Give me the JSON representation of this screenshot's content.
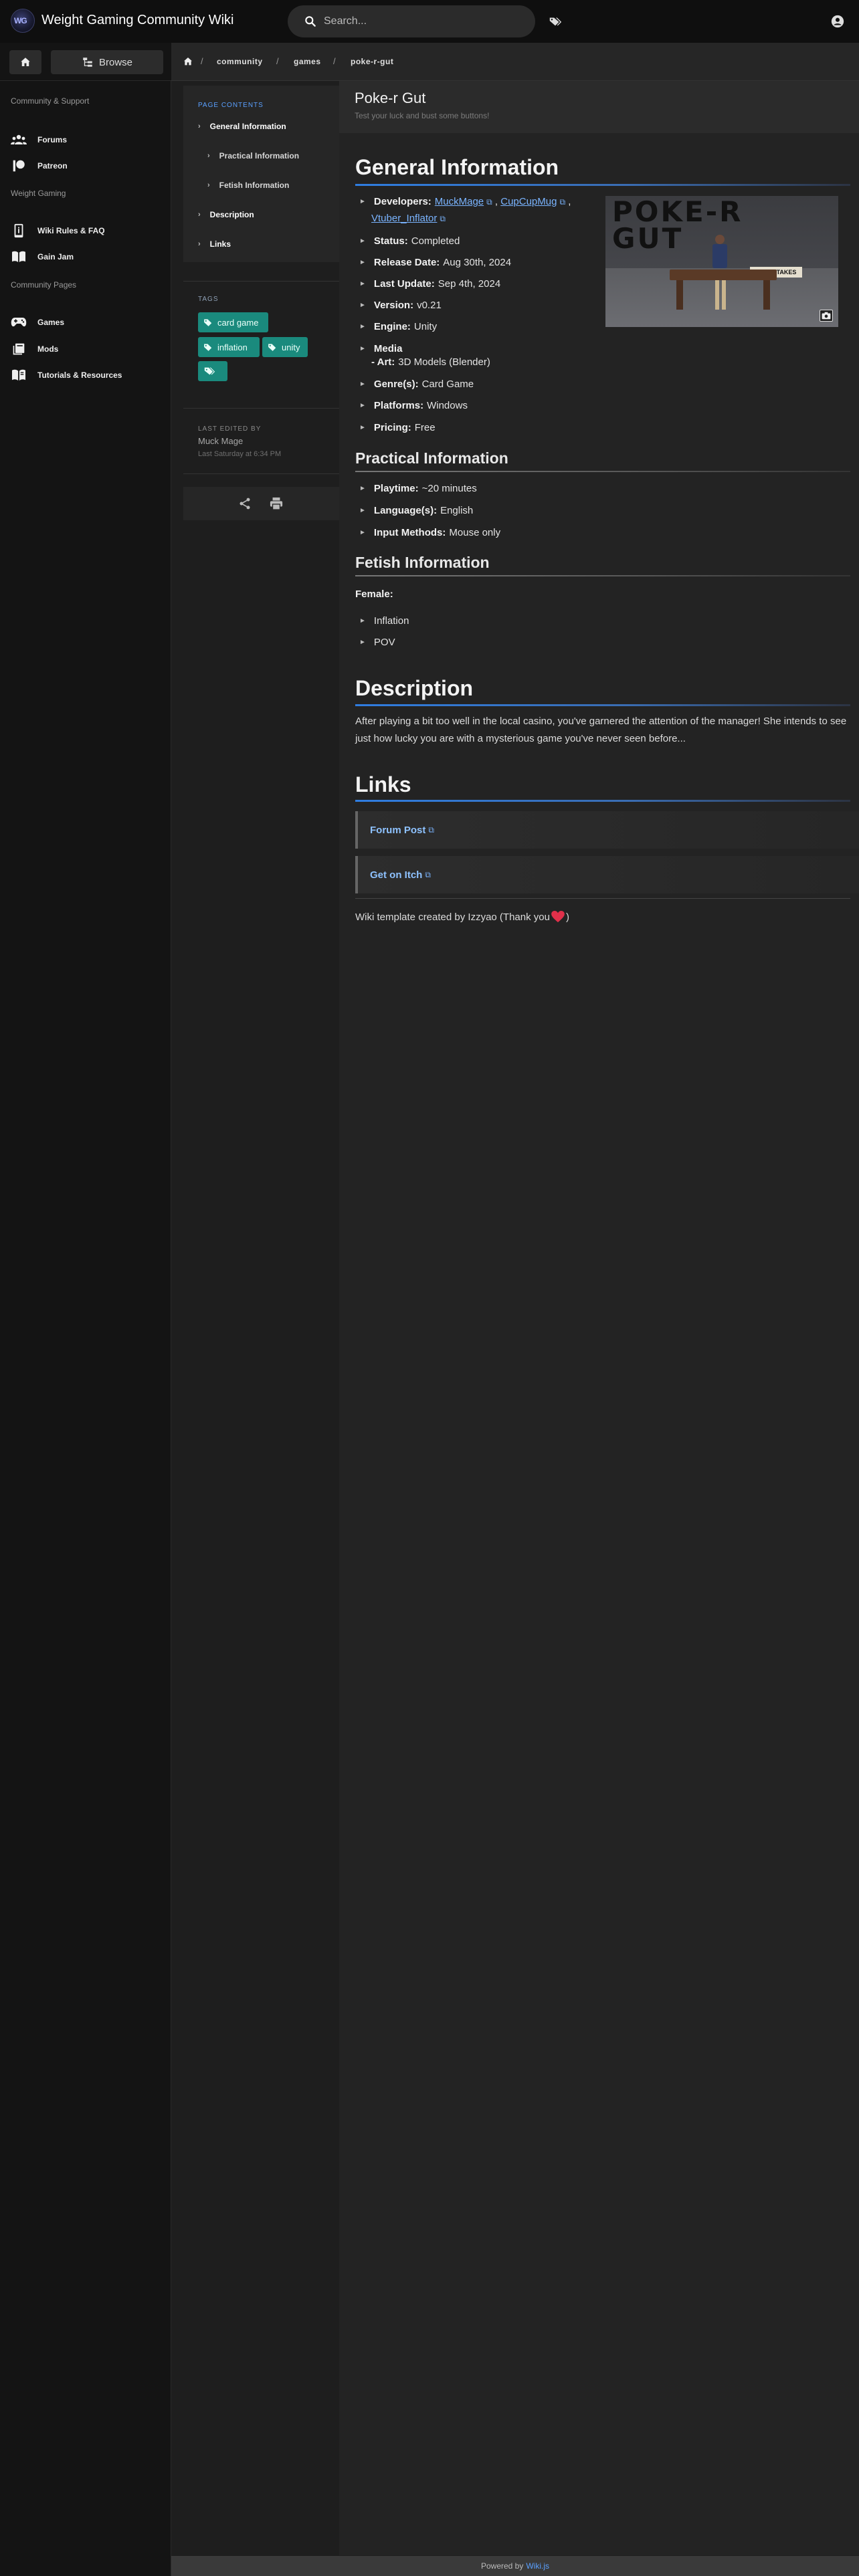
{
  "header": {
    "logo_text": "WG",
    "site_title": "Weight Gaming Community Wiki",
    "search_placeholder": "Search..."
  },
  "sidebar": {
    "browse_label": "Browse",
    "sections": {
      "community": "Community & Support",
      "weight_gaming": "Weight Gaming",
      "community_pages": "Community Pages"
    },
    "items": {
      "forums": "Forums",
      "patreon": "Patreon",
      "wiki_rules": "Wiki Rules & FAQ",
      "gain_jam": "Gain Jam",
      "games": "Games",
      "mods": "Mods",
      "tutorials": "Tutorials & Resources"
    }
  },
  "breadcrumb": [
    "community",
    "games",
    "poke-r-gut"
  ],
  "toc": {
    "label": "PAGE CONTENTS",
    "items": [
      "General Information",
      "Practical Information",
      "Fetish Information",
      "Description",
      "Links"
    ]
  },
  "tags": {
    "label": "TAGS",
    "items": [
      "card game",
      "inflation",
      "unity"
    ]
  },
  "last_edited": {
    "label": "LAST EDITED BY",
    "name": "Muck Mage",
    "time": "Last Saturday at 6:34 PM"
  },
  "page": {
    "title": "Poke-r Gut",
    "description": "Test your luck and bust some buttons!"
  },
  "general": {
    "heading": "General Information",
    "developers_label": "Developers:",
    "developers": [
      "MuckMage",
      "CupCupMug",
      "Vtuber_Inflator"
    ],
    "status_label": "Status:",
    "status": "Completed",
    "release_label": "Release Date:",
    "release": "Aug 30th, 2024",
    "update_label": "Last Update:",
    "update": "Sep 4th, 2024",
    "version_label": "Version:",
    "version": "v0.21",
    "engine_label": "Engine:",
    "engine": "Unity",
    "media_label": "Media",
    "art_label": "- Art:",
    "art": "3D Models (Blender)",
    "genre_label": "Genre(s):",
    "genre": "Card Game",
    "platforms_label": "Platforms:",
    "platforms": "Windows",
    "pricing_label": "Pricing:",
    "pricing": "Free"
  },
  "image": {
    "title_text": "POKE-R GUT",
    "sign_text": "HIGH STAKES"
  },
  "practical": {
    "heading": "Practical Information",
    "playtime_label": "Playtime:",
    "playtime": "~20 minutes",
    "language_label": "Language(s):",
    "language": "English",
    "input_label": "Input Methods:",
    "input": "Mouse only"
  },
  "fetish": {
    "heading": "Fetish Information",
    "female_label": "Female:",
    "items": [
      "Inflation",
      "POV"
    ]
  },
  "description": {
    "heading": "Description",
    "text": "After playing a bit too well in the local casino, you've garnered the attention of the manager! She intends to see just how lucky you are with a mysterious game you've never seen before..."
  },
  "links": {
    "heading": "Links",
    "items": [
      "Forum Post",
      "Get on Itch"
    ],
    "credit": "Wiki template created by Izzyao (Thank you "
  },
  "footer": {
    "powered": "Powered by",
    "engine": "Wiki.js"
  },
  "colors": {
    "accent": "#2f7de1",
    "tag": "#1a8a7d",
    "link": "#7ab4ff"
  }
}
